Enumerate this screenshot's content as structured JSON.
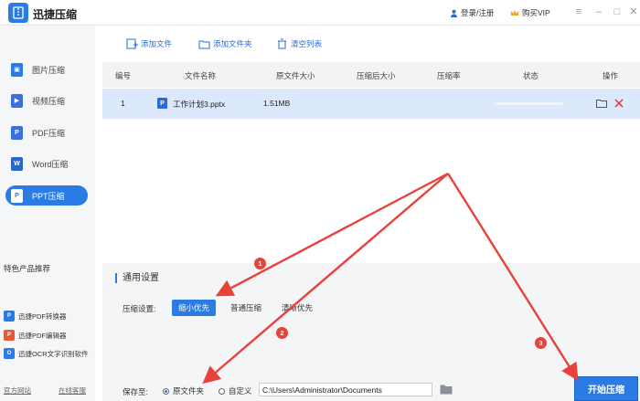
{
  "app": {
    "title": "迅捷压缩"
  },
  "header": {
    "login_label": "登录/注册",
    "vip_label": "购买VIP"
  },
  "window": {
    "icons": [
      "menu-icon",
      "minimize-icon",
      "maximize-icon",
      "close-icon"
    ]
  },
  "sidebar": {
    "items": [
      {
        "label": "图片压缩",
        "icon": "image-icon",
        "color": "#2a7be4"
      },
      {
        "label": "视频压缩",
        "icon": "video-icon",
        "color": "#3b6fd9"
      },
      {
        "label": "PDF压缩",
        "icon": "pdf-icon",
        "color": "#3b6fd9"
      },
      {
        "label": "Word压缩",
        "icon": "word-icon",
        "color": "#2b67c9"
      },
      {
        "label": "PPT压缩",
        "icon": "ppt-icon",
        "color": "#2a7be4"
      }
    ],
    "featured_title": "特色产品推荐",
    "products": [
      {
        "label": "迅捷PDF转换器",
        "icon": "pdf-converter-icon",
        "color": "#2a7be4"
      },
      {
        "label": "迅捷PDF编辑器",
        "icon": "pdf-editor-icon",
        "color": "#e25a3a"
      },
      {
        "label": "迅捷OCR文字识别软件",
        "icon": "ocr-icon",
        "color": "#2a7be4"
      }
    ],
    "footer_links": [
      "官方网站",
      "在线客服"
    ]
  },
  "toolbar": {
    "add_file": "添加文件",
    "add_folder": "添加文件夹",
    "clear_list": "清空列表"
  },
  "table": {
    "headers": [
      "编号",
      "文件名称",
      "原文件大小",
      "压缩后大小",
      "压缩率",
      "状态",
      "操作"
    ],
    "rows": [
      {
        "index": "1",
        "name": "工作计划3.pptx",
        "size": "1.51MB",
        "compressed": "",
        "ratio": "",
        "status": ""
      }
    ]
  },
  "settings": {
    "title": "通用设置",
    "compress_label": "压缩设置:",
    "options": [
      "缩小优先",
      "普通压缩",
      "清晰优先"
    ],
    "selected": "缩小优先",
    "save_label": "保存至:",
    "save_options": [
      "原文件夹",
      "自定义"
    ],
    "save_selected": "原文件夹",
    "path": "C:\\Users\\Administrator\\Documents",
    "start_button": "开始压缩"
  },
  "annotations": {
    "badges": [
      "1",
      "2",
      "3"
    ],
    "color": "#e8423a"
  },
  "colors": {
    "accent": "#2a7be4",
    "row_selected": "#dce8fb"
  }
}
